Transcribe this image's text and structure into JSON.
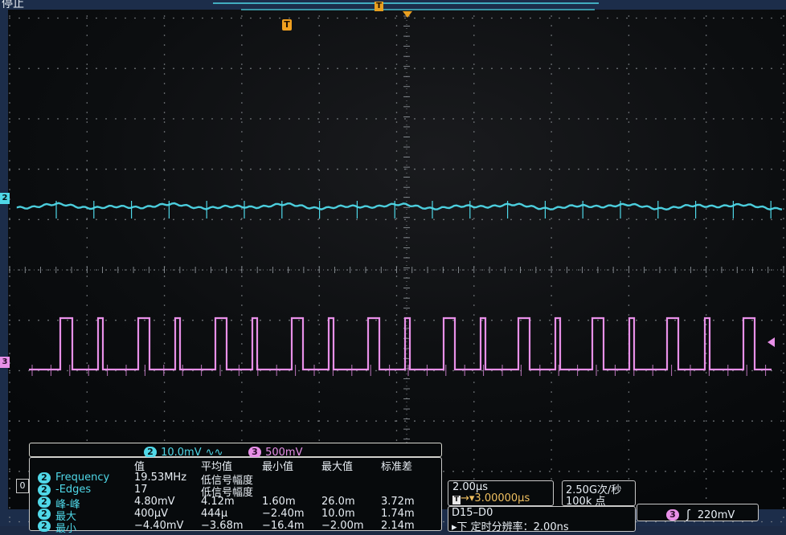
{
  "header": {
    "status_label": "停止",
    "trigger_marker": "T"
  },
  "channels": {
    "ch2": {
      "marker": "2",
      "scale": "10.0mV",
      "coupling_icon": "∿∿",
      "color": "#4fd8e8"
    },
    "ch3": {
      "marker": "3",
      "scale": "500mV",
      "color": "#e890e8"
    }
  },
  "measurements": {
    "menu_marker": "0",
    "columns": [
      "值",
      "平均值",
      "最小值",
      "最大值",
      "标准差"
    ],
    "rows": [
      {
        "ch": "2",
        "name": "Frequency",
        "cells": [
          "19.53MHz",
          "低信号幅度",
          "",
          "",
          ""
        ]
      },
      {
        "ch": "2",
        "name": "-Edges",
        "cells": [
          "17",
          "低信号幅度",
          "",
          "",
          ""
        ]
      },
      {
        "ch": "2",
        "name": "峰-峰",
        "cells": [
          "4.80mV",
          "4.12m",
          "1.60m",
          "26.0m",
          "3.72m"
        ]
      },
      {
        "ch": "2",
        "name": "最大",
        "cells": [
          "400µV",
          "444µ",
          "−2.40m",
          "10.0m",
          "1.74m"
        ]
      },
      {
        "ch": "2",
        "name": "最小",
        "cells": [
          "−4.40mV",
          "−3.68m",
          "−16.4m",
          "−2.00m",
          "2.14m"
        ]
      }
    ]
  },
  "timebase": {
    "scale": "2.00µs",
    "delay_icon": "T",
    "delay": "→▾3.00000µs",
    "sample_rate": "2.50G次/秒",
    "record_length": "100k 点"
  },
  "digital": {
    "label": "D15–D0",
    "sub": "▸下 定时分辨率：2.00ns"
  },
  "trigger": {
    "source": "3",
    "edge_icon": "ʃ",
    "level": "220mV"
  }
}
